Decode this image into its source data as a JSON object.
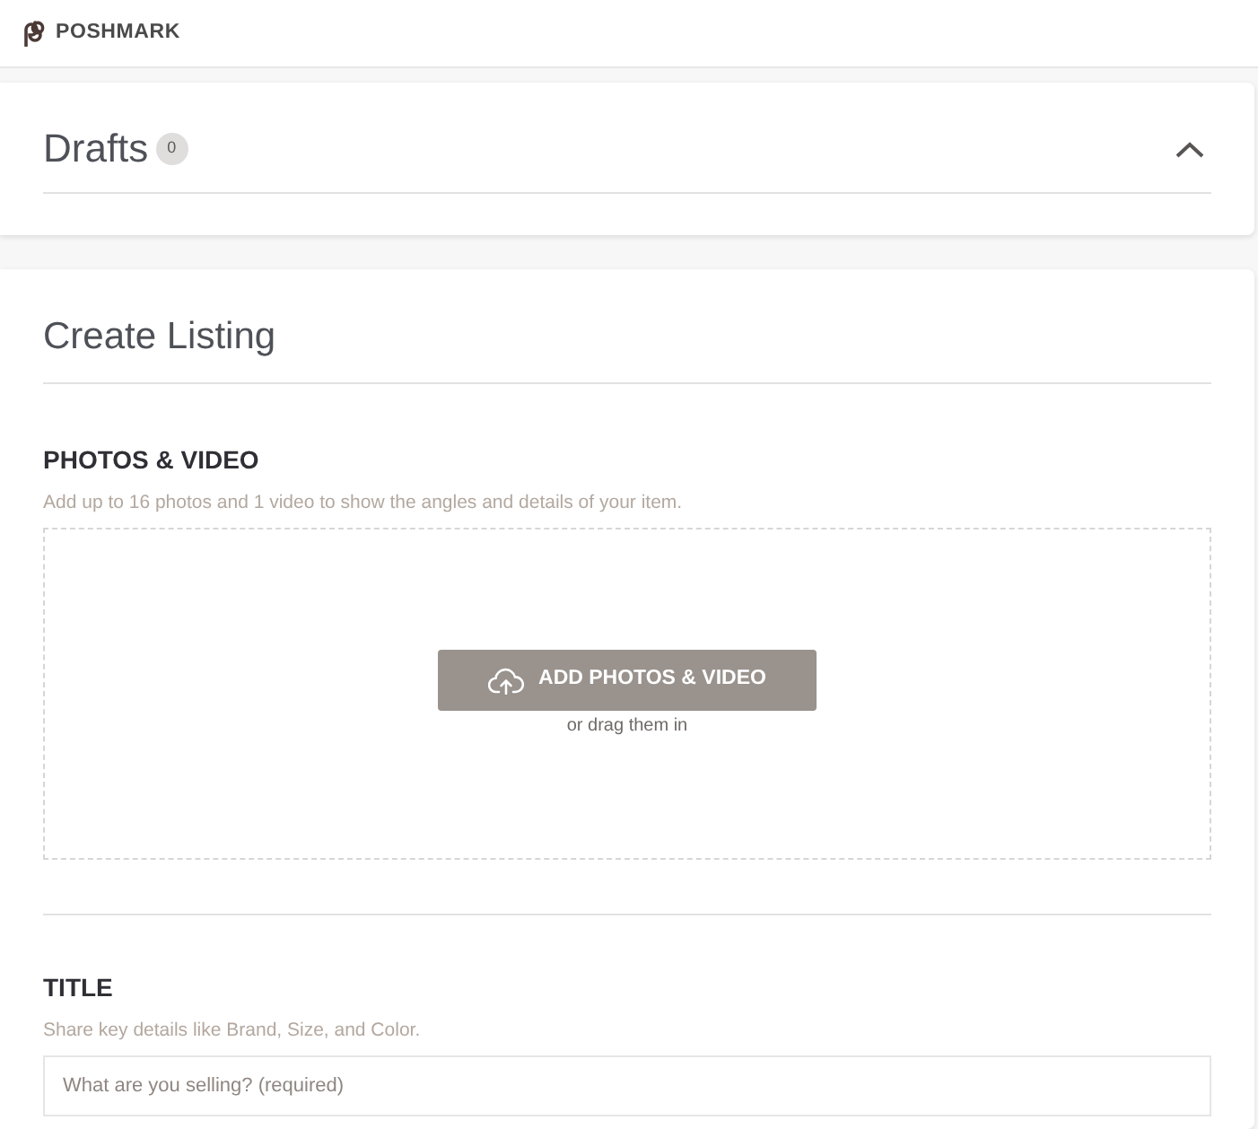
{
  "header": {
    "logo_text": "POSHMARK"
  },
  "drafts": {
    "title": "Drafts",
    "count": "0",
    "expanded": true
  },
  "create_listing": {
    "title": "Create Listing",
    "sections": [
      {
        "kind": "upload",
        "heading": "PHOTOS & VIDEO",
        "hint": "Add up to 16 photos and 1 video to show the angles and details of your item.",
        "button": "ADD PHOTOS & VIDEO",
        "drop_hint": "or drag them in"
      },
      {
        "kind": "text",
        "heading": "TITLE",
        "hint": "Share key details like Brand, Size, and Color.",
        "placeholder": "What are you selling? (required)"
      }
    ]
  }
}
